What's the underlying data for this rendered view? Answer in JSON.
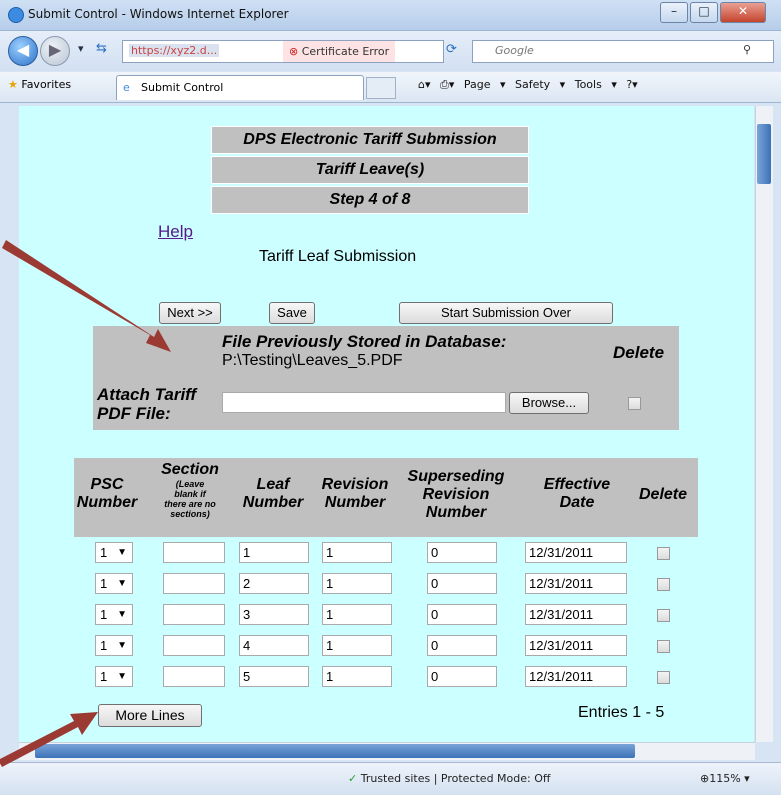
{
  "window": {
    "title": "Submit Control - Windows Internet Explorer",
    "url": "https://xyz2.d...",
    "cert_error": "Certificate Error",
    "search_placeholder": "Google",
    "favorites_label": "Favorites",
    "tab_label": "Submit Control",
    "toolbar": {
      "page": "Page ▾",
      "safety": "Safety ▾",
      "tools": "Tools ▾"
    },
    "status_text": "Trusted sites | Protected Mode: Off",
    "zoom": "115%"
  },
  "page": {
    "header": [
      "DPS Electronic Tariff Submission",
      "Tariff Leave(s)",
      "Step 4 of 8"
    ],
    "help_link": "Help",
    "subtitle": "Tariff Leaf Submission",
    "buttons": {
      "next": "Next >>",
      "save": "Save",
      "start_over": "Start Submission Over",
      "browse": "Browse...",
      "more_lines": "More Lines"
    },
    "file": {
      "stored_label": "File Previously Stored in Database:",
      "stored_path": "P:\\Testing\\Leaves_5.PDF",
      "delete_label": "Delete",
      "attach_label_1": "Attach Tariff",
      "attach_label_2": "PDF File:"
    },
    "table": {
      "headers": {
        "psc": [
          "PSC",
          "Number"
        ],
        "section": "Section",
        "section_note": [
          "(Leave",
          "blank if",
          "there are no",
          "sections)"
        ],
        "leaf": [
          "Leaf",
          "Number"
        ],
        "revision": [
          "Revision",
          "Number"
        ],
        "superseding": [
          "Superseding",
          "Revision",
          "Number"
        ],
        "effective": [
          "Effective",
          "Date"
        ],
        "delete": "Delete"
      },
      "rows": [
        {
          "psc": "1",
          "section": "",
          "leaf": "1",
          "revision": "1",
          "superseding": "0",
          "date": "12/31/2011"
        },
        {
          "psc": "1",
          "section": "",
          "leaf": "2",
          "revision": "1",
          "superseding": "0",
          "date": "12/31/2011"
        },
        {
          "psc": "1",
          "section": "",
          "leaf": "3",
          "revision": "1",
          "superseding": "0",
          "date": "12/31/2011"
        },
        {
          "psc": "1",
          "section": "",
          "leaf": "4",
          "revision": "1",
          "superseding": "0",
          "date": "12/31/2011"
        },
        {
          "psc": "1",
          "section": "",
          "leaf": "5",
          "revision": "1",
          "superseding": "0",
          "date": "12/31/2011"
        }
      ]
    },
    "entries_label": "Entries 1 - 5"
  },
  "colors": {
    "page_bg": "#ccffff",
    "grey_panel": "#c0c0c0",
    "arrow": "#9b3a32"
  }
}
